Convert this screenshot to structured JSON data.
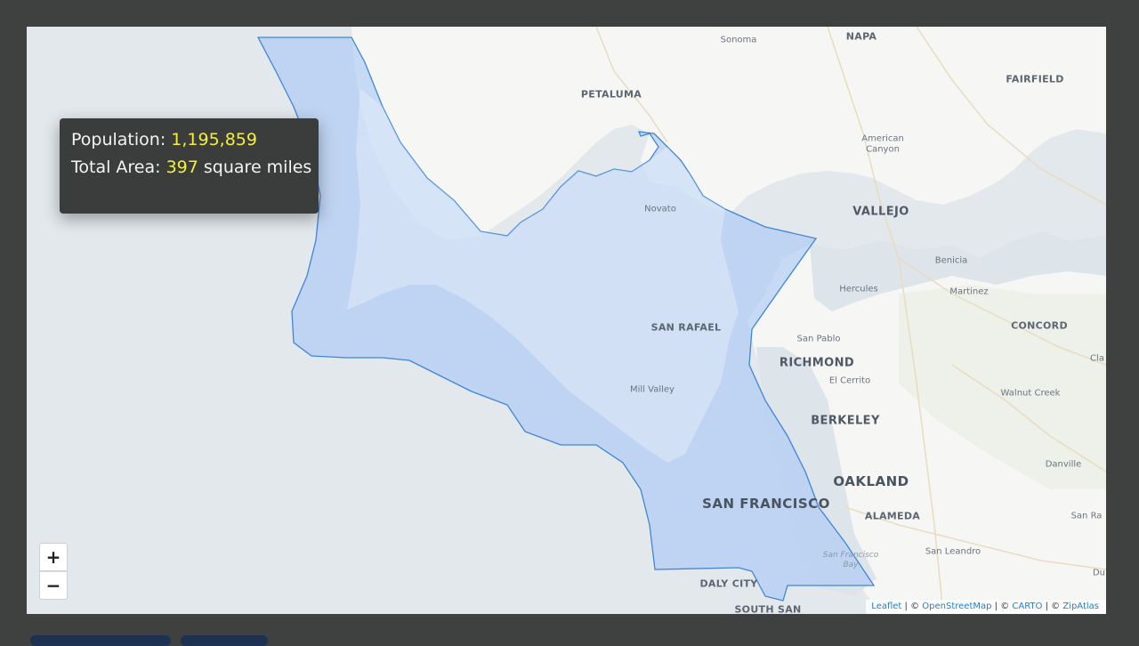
{
  "tooltip": {
    "population_label": "Population:",
    "population_value": "1,195,859",
    "area_label": "Total Area:",
    "area_value": "397",
    "area_unit": "square miles"
  },
  "zoom": {
    "in_label": "+",
    "out_label": "−"
  },
  "attribution": {
    "leaflet": "Leaflet",
    "osm": "OpenStreetMap",
    "carto": "CARTO",
    "zipatlas": "ZipAtlas",
    "sep1": " | © ",
    "sep2": " | © ",
    "sep3": " | © "
  },
  "places": {
    "sonoma": "Sonoma",
    "napa": "NAPA",
    "petaluma": "PETALUMA",
    "fairfield": "FAIRFIELD",
    "american_canyon_1": "American",
    "american_canyon_2": "Canyon",
    "novato": "Novato",
    "vallejo": "VALLEJO",
    "benicia": "Benicia",
    "hercules": "Hercules",
    "martinez": "Martinez",
    "san_rafael": "SAN RAFAEL",
    "concord": "CONCORD",
    "san_pablo": "San Pablo",
    "richmond": "RICHMOND",
    "clayton": "Cla",
    "el_cerrito": "El Cerrito",
    "mill_valley": "Mill Valley",
    "walnut_creek": "Walnut Creek",
    "berkeley": "BERKELEY",
    "danville": "Danville",
    "oakland": "OAKLAND",
    "san_francisco": "SAN FRANCISCO",
    "alameda": "ALAMEDA",
    "san_ramon": "San Ra",
    "sf_bay_1": "San Francisco",
    "sf_bay_2": "Bay",
    "san_leandro": "San Leandro",
    "daly_city": "DALY CITY",
    "dublin": "Du",
    "south_san": "SOUTH SAN"
  },
  "colors": {
    "region_fill": "#a9c8f5",
    "region_stroke": "#3f86d6",
    "highlight_text": "#f4f03a"
  }
}
